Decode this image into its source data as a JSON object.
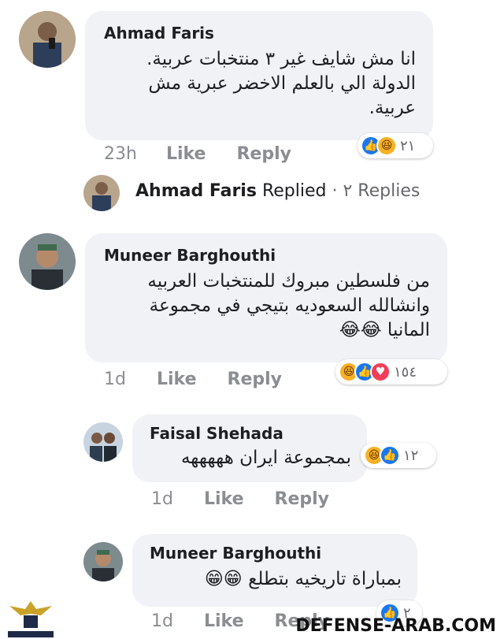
{
  "comments": [
    {
      "author": "Ahmad Faris",
      "text": "انا مش شايف غير ٣ منتخبات عربية.\nالدولة الي بالعلم الاخضر عبرية مش\nعربية.",
      "time": "23h",
      "like_label": "Like",
      "reply_label": "Reply",
      "reaction_count": "٢١",
      "reactions": [
        "like",
        "haha"
      ],
      "avatar_color": "#8d7a66"
    },
    {
      "author": "Muneer Barghouthi",
      "text": "من فلسطين مبروك للمنتخبات العربيه\nوانشالله السعوديه بتيجي في مجموعة\nالمانيا 😂😂",
      "time": "1d",
      "like_label": "Like",
      "reply_label": "Reply",
      "reaction_count": "١٥٤",
      "reactions": [
        "haha",
        "like",
        "love"
      ],
      "avatar_color": "#5c6a6e"
    }
  ],
  "replied_row": {
    "author": "Ahmad Faris",
    "replied_label": "Replied",
    "separator": "·",
    "replies_count": "٢ Replies"
  },
  "replies": [
    {
      "author": "Faisal Shehada",
      "text": "بمجموعة ايران هههههه",
      "time": "1d",
      "like_label": "Like",
      "reply_label": "Reply",
      "reaction_count": "١٢",
      "reactions": [
        "haha",
        "like"
      ],
      "avatar_color": "#3c4a5a"
    },
    {
      "author": "Muneer Barghouthi",
      "text": "بمباراة تاريخيه بتطلع 😁😁",
      "time": "1d",
      "like_label": "Like",
      "reply_label": "Reply",
      "reaction_count": "٢",
      "reactions": [
        "like"
      ],
      "avatar_color": "#5c6a6e"
    }
  ],
  "watermark": "DEFENSE-ARAB.COM"
}
